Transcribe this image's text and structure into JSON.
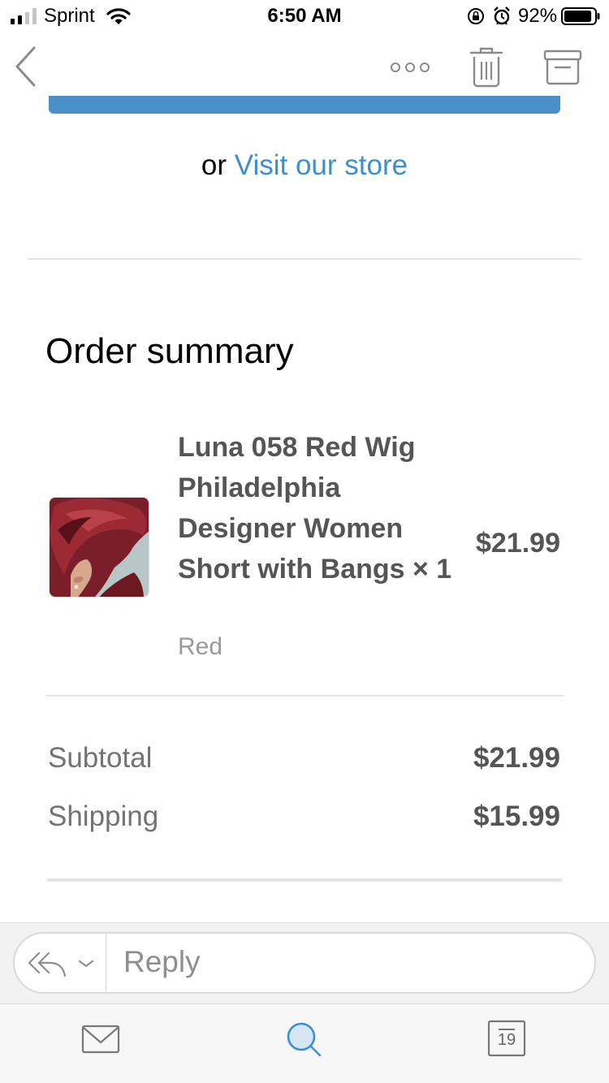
{
  "status_bar": {
    "carrier": "Sprint",
    "time": "6:50 AM",
    "battery_percent": "92%",
    "signal_bars": 2,
    "battery_level": 0.92
  },
  "nav": {
    "back_icon": "chevron-left-icon",
    "more_icon": "more-icon",
    "delete_icon": "trash-icon",
    "archive_icon": "archive-icon"
  },
  "email": {
    "or_text": "or",
    "visit_link": "Visit our store",
    "order_summary_title": "Order summary",
    "item": {
      "name": "Luna 058 Red Wig Philadelphia Designer Women Short with Bangs × 1",
      "variant": "Red",
      "price": "$21.99"
    },
    "subtotal_label": "Subtotal",
    "subtotal_value": "$21.99",
    "shipping_label": "Shipping",
    "shipping_value": "$15.99"
  },
  "reply": {
    "placeholder": "Reply"
  },
  "tabs": {
    "calendar_day": "19"
  },
  "colors": {
    "link": "#3d8fcf",
    "button_blue": "#4a8fc6",
    "icon_blue": "#3a8fd6"
  }
}
